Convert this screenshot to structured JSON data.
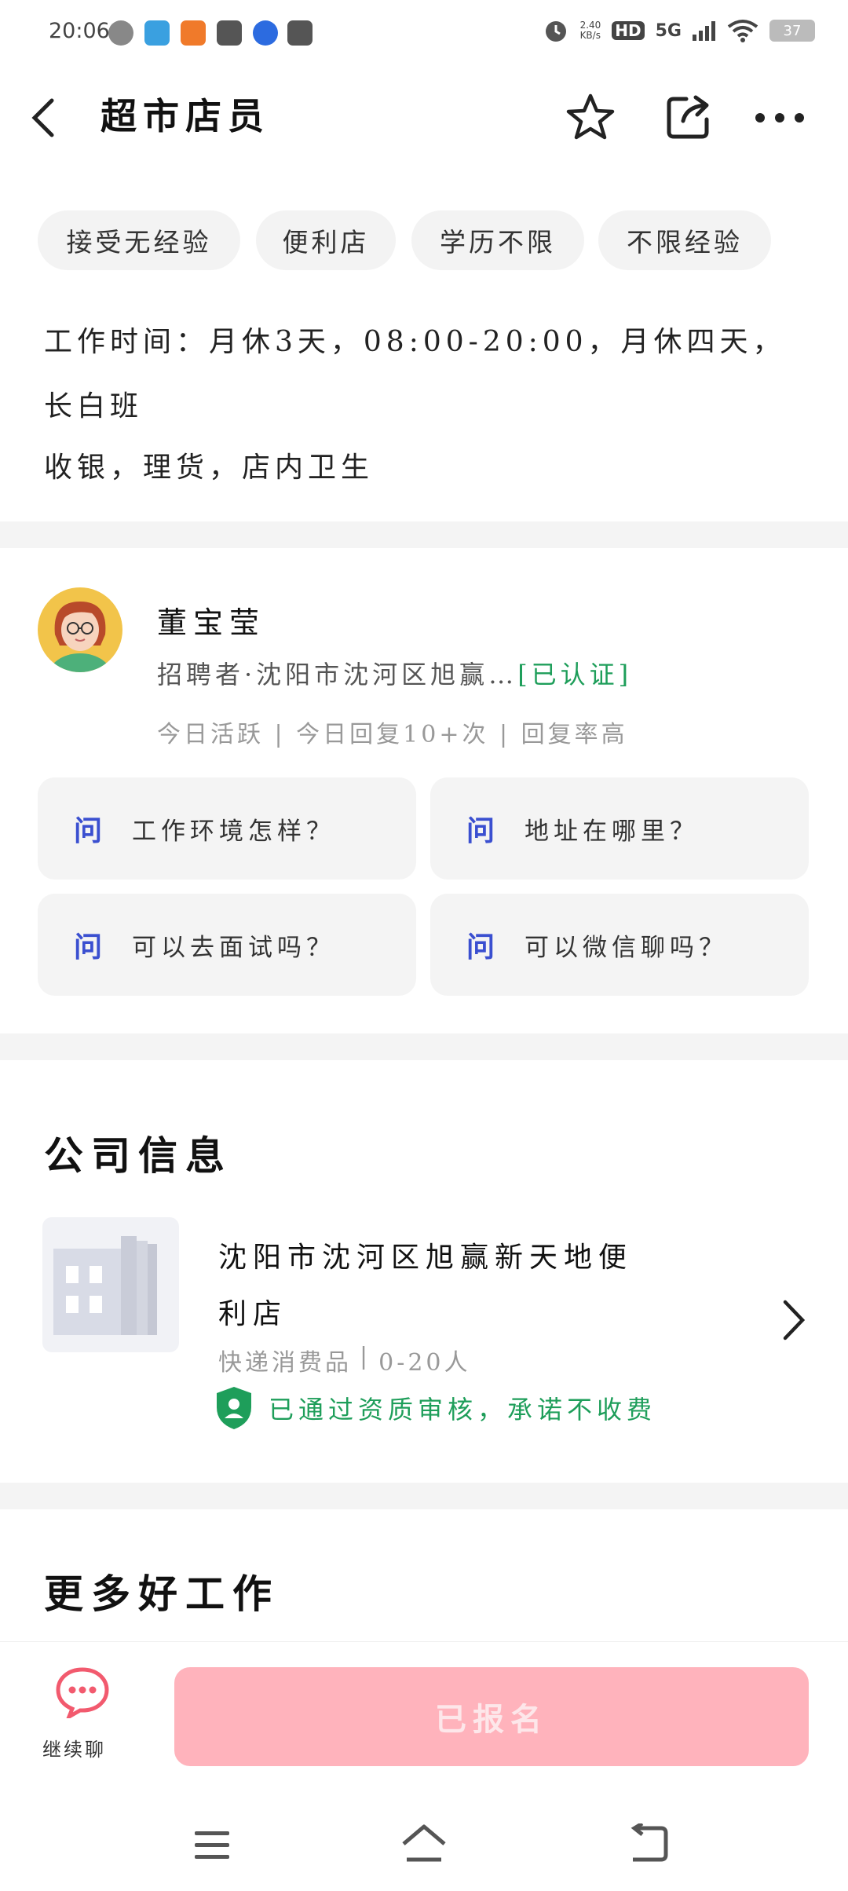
{
  "status_bar": {
    "time": "20:06",
    "network_speed": "2.40\nKB/s",
    "hd": "HD",
    "signal": "5G",
    "battery": "37"
  },
  "header": {
    "title": "超市店员",
    "back_icon": "chevron-left-icon",
    "favorite_icon": "star-outline-icon",
    "share_icon": "share-icon",
    "more_icon": "more-horizontal-icon"
  },
  "tags": [
    "接受无经验",
    "便利店",
    "学历不限",
    "不限经验"
  ],
  "work_time": "工作时间：月休3天，08:00-20:00，月休四天，",
  "work_time_line2": "长白班",
  "duties": "收银，理货，店内卫生",
  "recruiter": {
    "name": "董宝莹",
    "info": "招聘者·沈阳市沈河区旭赢…",
    "verified": "[已认证]",
    "activity": "今日活跃 | 今日回复10+次 | 回复率高"
  },
  "questions": [
    {
      "mark": "问",
      "text": "工作环境怎样？"
    },
    {
      "mark": "问",
      "text": "地址在哪里？"
    },
    {
      "mark": "问",
      "text": "可以去面试吗？"
    },
    {
      "mark": "问",
      "text": "可以微信聊吗？"
    }
  ],
  "company_section": {
    "title": "公司信息",
    "name_line1": "沈阳市沈河区旭赢新天地便",
    "name_line2": "利店",
    "meta_industry": "快递消费品",
    "meta_size": "0-20人",
    "verified_text": "已通过资质审核，承诺不收费"
  },
  "more_jobs": {
    "title": "更多好工作"
  },
  "bottom": {
    "chat_label": "继续聊",
    "apply_label": "已报名"
  },
  "colors": {
    "accent_blue": "#3a4fd0",
    "verified_green": "#1e9e5a",
    "apply_pink": "#ffb3bc"
  }
}
